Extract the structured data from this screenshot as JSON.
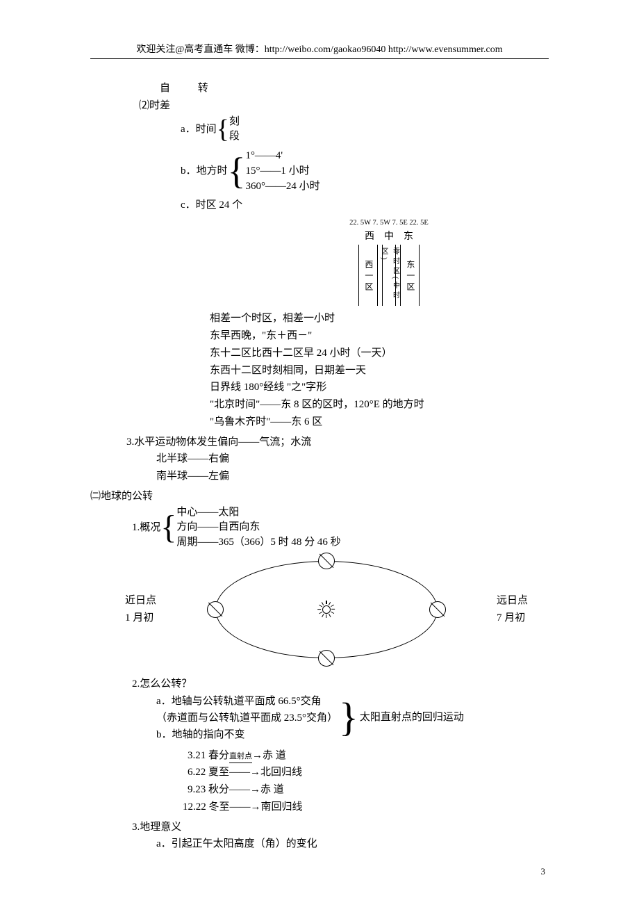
{
  "header": "欢迎关注@高考直通车  微博：http://weibo.com/gaokao96040    http://www.evensummer.com",
  "section1": {
    "title": "自    转",
    "diff_title": "⑵时差",
    "time_label": "a．时间",
    "time_items": [
      "刻",
      "段"
    ],
    "local_label": "b．地方时",
    "local_items": [
      "1°——4'",
      "15°——1 小时",
      "360°——24 小时"
    ],
    "tz_label": "c．时区  24 个",
    "tz_coords": "22. 5W 7. 5W 7. 5E 22. 5E",
    "tz_row1": [
      "西",
      "中",
      "东"
    ],
    "tz_cols": [
      "西一区",
      "零时区(中时区)",
      "东一区"
    ],
    "tz_notes": [
      "相差一个时区，相差一小时",
      "东早西晚，\"东＋西－\"",
      "东十二区比西十二区早 24 小时（一天）",
      "东西十二区时刻相同，日期差一天",
      "日界线 180°经线        \"之\"字形",
      "\"北京时间\"——东 8 区的区时，120°E 的地方时",
      "\"乌鲁木齐时\"——东 6 区"
    ],
    "deflection": {
      "title": "3.水平运动物体发生偏向——气流；水流",
      "north": "北半球——右偏",
      "south": "南半球——左偏"
    }
  },
  "section2": {
    "heading": "㈡地球的公转",
    "overview_label": "1.概况",
    "overview_items": [
      "中心——太阳",
      "方向——自西向东",
      "周期——365（366）5 时 48 分 46 秒"
    ],
    "left_label": {
      "l1": "近日点",
      "l2": "1 月初"
    },
    "right_label": {
      "l1": "远日点",
      "l2": "7 月初"
    },
    "how_title": "2.怎么公转？",
    "how_a1": "a．地轴与公转轨道平面成 66.5°交角",
    "how_a2": "（赤道面与公转轨道平面成 23.5°交角）",
    "how_b": "b．地轴的指向不变",
    "how_result": "太阳直射点的回归运动",
    "dates": [
      {
        "d": "3.21 春分",
        "mid": "直射点",
        "t": "赤        道"
      },
      {
        "d": "6.22 夏至——→北回归线"
      },
      {
        "d": "9.23 秋分——→赤        道"
      },
      {
        "d": "12.22 冬至——→南回归线"
      }
    ],
    "meaning": {
      "title": "3.地理意义",
      "a": "a．引起正午太阳高度（角）的变化"
    }
  },
  "page_num": "3"
}
